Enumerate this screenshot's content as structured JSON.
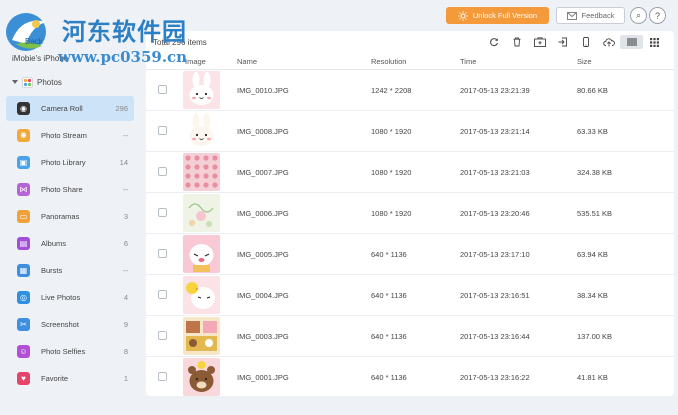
{
  "watermark": {
    "title": "河东软件园",
    "url": "www.pc0359.cn"
  },
  "topbar": {
    "unlock_label": "Unlock Full Version",
    "feedback_label": "Feedback",
    "search_glyph": "⌕",
    "help_glyph": "?"
  },
  "sidebar": {
    "device_name": "iMobie's iPhone",
    "photos_label": "Photos",
    "items": [
      {
        "label": "Camera Roll",
        "count": "296",
        "icon": "camera-icon",
        "color": "#333333",
        "glyph": "◉"
      },
      {
        "label": "Photo Stream",
        "count": "--",
        "icon": "sunflower-icon",
        "color": "#f2a93b",
        "glyph": "✺"
      },
      {
        "label": "Photo Library",
        "count": "14",
        "icon": "photo-library-icon",
        "color": "#4aa3e8",
        "glyph": "▣"
      },
      {
        "label": "Photo Share",
        "count": "--",
        "icon": "share-icon",
        "color": "#b564d8",
        "glyph": "⋈"
      },
      {
        "label": "Panoramas",
        "count": "3",
        "icon": "panorama-icon",
        "color": "#f0a13a",
        "glyph": "▭"
      },
      {
        "label": "Albums",
        "count": "6",
        "icon": "albums-icon",
        "color": "#a04fd6",
        "glyph": "▤"
      },
      {
        "label": "Bursts",
        "count": "--",
        "icon": "bursts-icon",
        "color": "#3f8fe0",
        "glyph": "▦"
      },
      {
        "label": "Live Photos",
        "count": "4",
        "icon": "live-photos-icon",
        "color": "#2f8fe0",
        "glyph": "◎"
      },
      {
        "label": "Screenshot",
        "count": "9",
        "icon": "screenshot-icon",
        "color": "#3f8fe0",
        "glyph": "✂"
      },
      {
        "label": "Photo Selfies",
        "count": "8",
        "icon": "selfie-icon",
        "color": "#b34fd6",
        "glyph": "☺"
      },
      {
        "label": "Favorite",
        "count": "1",
        "icon": "heart-icon",
        "color": "#e8436a",
        "glyph": "♥"
      }
    ]
  },
  "main": {
    "total_items": "Total 296 items",
    "columns": {
      "image": "Image",
      "name": "Name",
      "resolution": "Resolution",
      "time": "Time",
      "size": "Size"
    },
    "toolbar_icons": [
      "refresh-icon",
      "delete-icon",
      "add-photo-icon",
      "export-icon",
      "to-device-icon",
      "upload-cloud-icon",
      "list-view-icon",
      "grid-view-icon"
    ],
    "rows": [
      {
        "name": "IMG_0010.JPG",
        "resolution": "1242 * 2208",
        "time": "2017-05-13 23:21:39",
        "size": "80.66 KB",
        "thumb": "bunny-pink"
      },
      {
        "name": "IMG_0008.JPG",
        "resolution": "1080 * 1920",
        "time": "2017-05-13 23:21:14",
        "size": "63.33 KB",
        "thumb": "bunny-white"
      },
      {
        "name": "IMG_0007.JPG",
        "resolution": "1080 * 1920",
        "time": "2017-05-13 23:21:03",
        "size": "324.38 KB",
        "thumb": "pattern-pink"
      },
      {
        "name": "IMG_0006.JPG",
        "resolution": "1080 * 1920",
        "time": "2017-05-13 23:20:46",
        "size": "535.51 KB",
        "thumb": "pattern-green"
      },
      {
        "name": "IMG_0005.JPG",
        "resolution": "640 * 1136",
        "time": "2017-05-13 23:17:10",
        "size": "63.94 KB",
        "thumb": "cony-pink"
      },
      {
        "name": "IMG_0004.JPG",
        "resolution": "640 * 1136",
        "time": "2017-05-13 23:16:51",
        "size": "38.34 KB",
        "thumb": "cony-chick"
      },
      {
        "name": "IMG_0003.JPG",
        "resolution": "640 * 1136",
        "time": "2017-05-13 23:16:44",
        "size": "137.00 KB",
        "thumb": "collage"
      },
      {
        "name": "IMG_0001.JPG",
        "resolution": "640 * 1136",
        "time": "2017-05-13 23:16:22",
        "size": "41.81 KB",
        "thumb": "brown-bear"
      }
    ]
  },
  "colors": {
    "accent": "#f49a3b",
    "selected": "#cde3f7",
    "watermark": "#2b7fc4"
  }
}
